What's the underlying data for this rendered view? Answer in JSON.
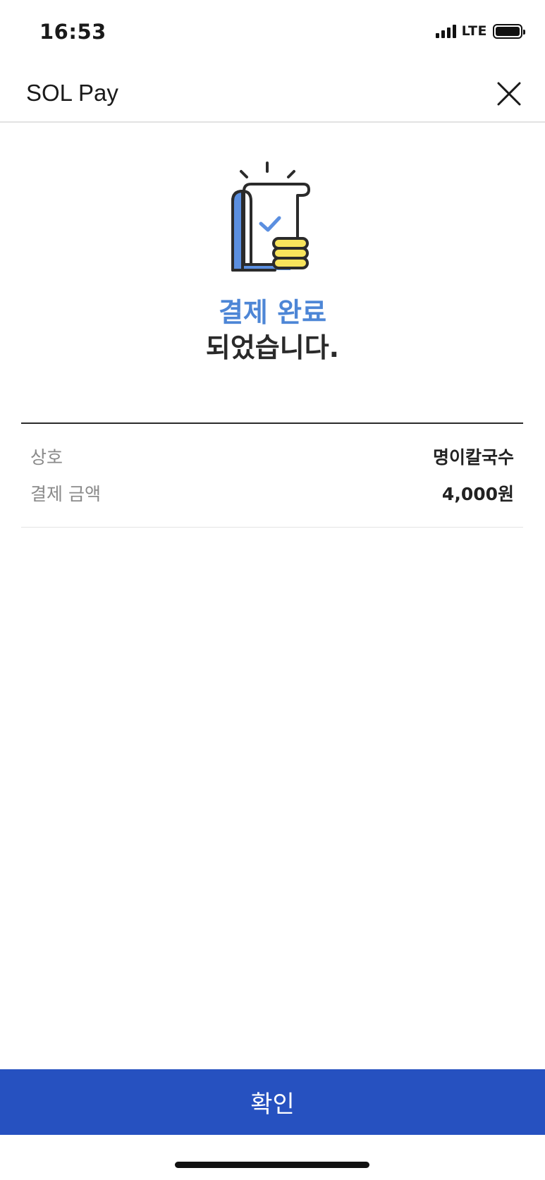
{
  "status_bar": {
    "time": "16:53",
    "network": "LTE",
    "signal_bars": 4,
    "battery_level": 1.0
  },
  "header": {
    "title": "SOL Pay",
    "close_icon": "close-icon"
  },
  "hero": {
    "icon": "receipt-check-coins-icon",
    "line1": "결제 완료",
    "line2": "되었습니다."
  },
  "details": {
    "rows": [
      {
        "label": "상호",
        "value": "명이칼국수"
      },
      {
        "label": "결제 금액",
        "value": "4,000원"
      }
    ]
  },
  "confirm_button": {
    "label": "확인"
  },
  "colors": {
    "accent_blue": "#4d86d6",
    "button_blue": "#2651c0",
    "coin_yellow": "#f8e45c",
    "icon_blue": "#5b8fe0"
  }
}
